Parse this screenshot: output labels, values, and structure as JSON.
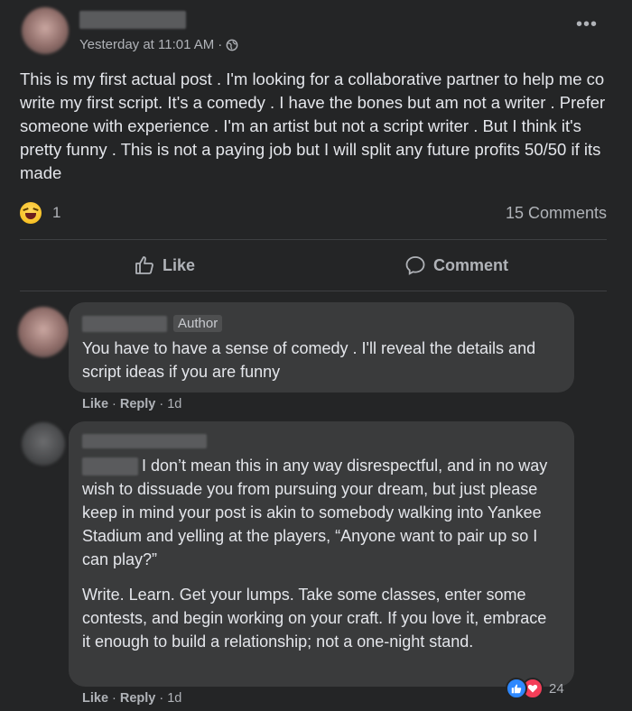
{
  "post": {
    "timestamp": "Yesterday at 11:01 AM",
    "separator": "·",
    "text": "This is my first actual post . I'm looking for a collaborative partner to help me co write my first script. It's a comedy . I have the bones but am not a writer . Prefer someone with experience . I'm an artist but not a script writer . But I think it's pretty funny . This is not a paying job but I will split any future profits 50/50 if its made",
    "more_label": "•••",
    "reaction_count": "1",
    "comments_label": "15 Comments",
    "like_label": "Like",
    "comment_label": "Comment"
  },
  "comments": [
    {
      "badge": "Author",
      "text": "You have to have a sense of comedy . I'll reveal the details and script ideas if you are funny",
      "like": "Like",
      "reply": "Reply",
      "dot": "·",
      "time": "1d"
    },
    {
      "paragraph1": "I don’t mean this in any way disrespectful, and in no way wish to dissuade you from pursuing your dream, but just please keep in mind your post is akin to somebody walking into Yankee Stadium and yelling at the players, “Anyone want to pair up so I can play?”",
      "paragraph2": "Write. Learn. Get your lumps. Take some classes, enter some contests, and begin working on your craft. If you love it, embrace it enough to build a relationship; not a one-night stand.",
      "reaction_count": "24",
      "like": "Like",
      "reply": "Reply",
      "dot": "·",
      "time": "1d"
    }
  ],
  "colors": {
    "background": "#242526",
    "bubble": "#3a3b3c",
    "text": "#e4e6eb",
    "secondary_text": "#b0b3b8",
    "like_blue": "#2d88ff",
    "love_red": "#f33e58"
  },
  "icons": {
    "privacy": "globe-icon",
    "reaction": "haha-icon",
    "like": "thumbs-up-icon",
    "comment": "speech-bubble-icon"
  }
}
